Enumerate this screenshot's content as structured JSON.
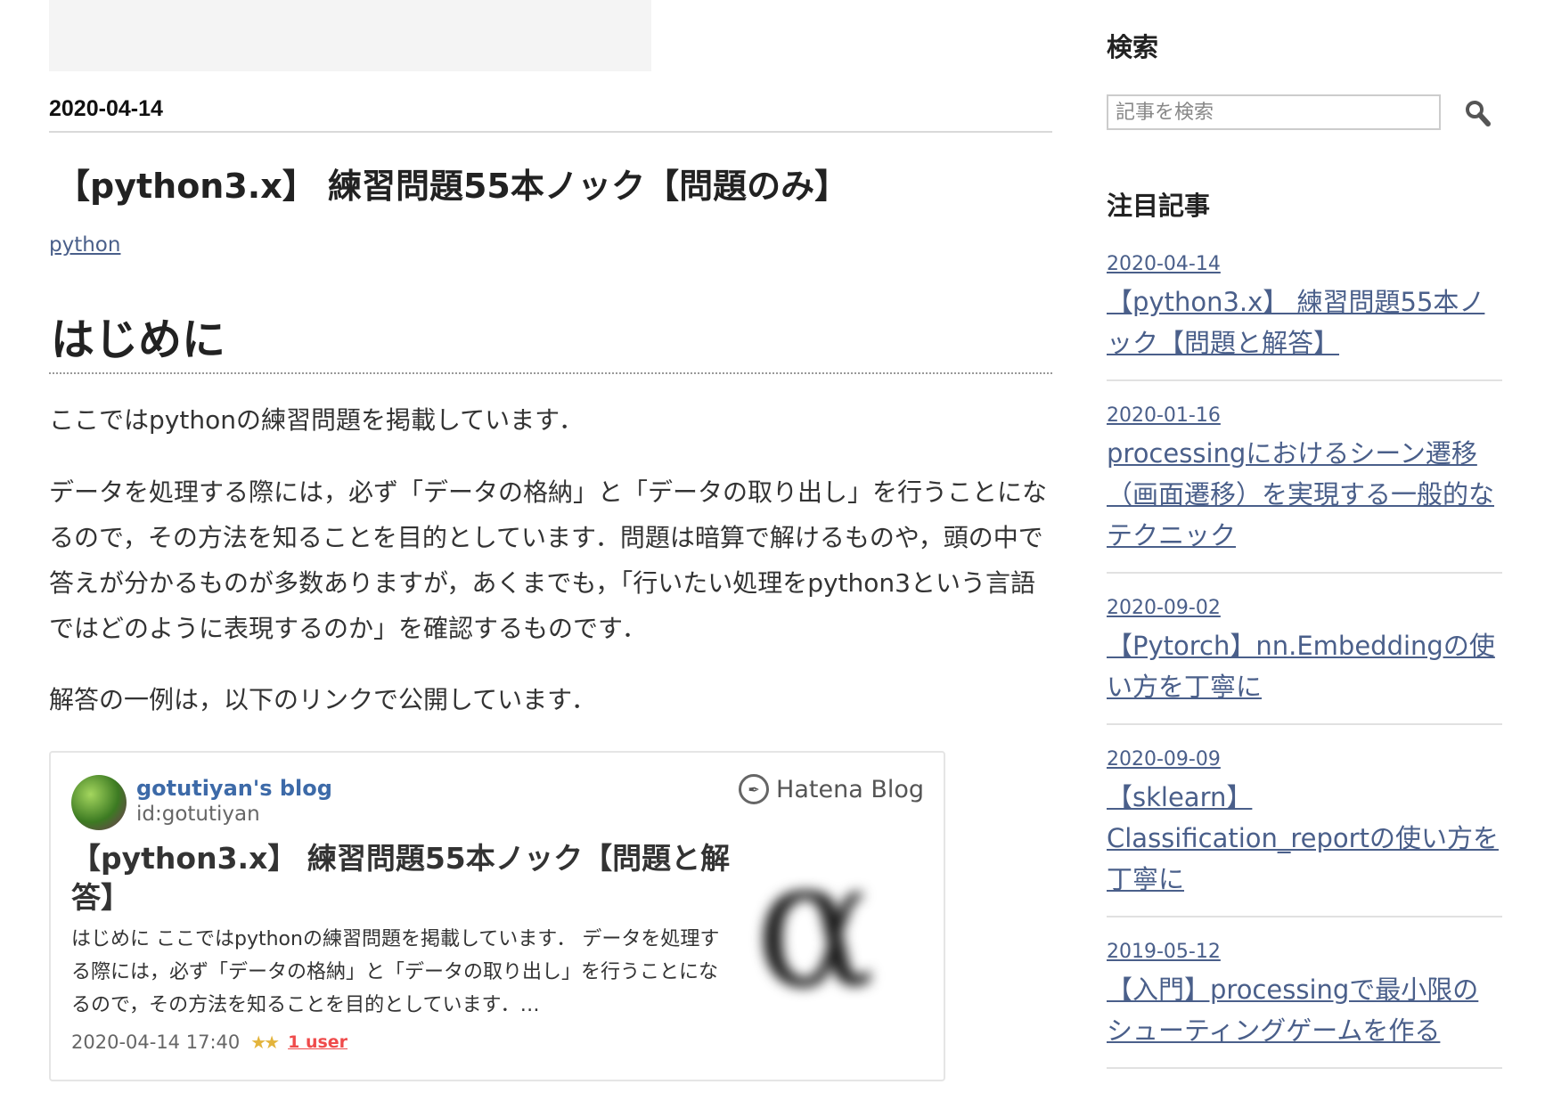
{
  "article": {
    "date": "2020-04-14",
    "title": "【python3.x】 練習問題55本ノック【問題のみ】",
    "category": "python",
    "section_heading": "はじめに",
    "paragraphs": [
      "ここではpythonの練習問題を掲載しています．",
      "データを処理する際には，必ず「データの格納」と「データの取り出し」を行うことになるので，その方法を知ることを目的としています．問題は暗算で解けるものや，頭の中で答えが分かるものが多数ありますが，あくまでも，「行いたい処理をpython3という言語ではどのように表現するのか」を確認するものです．",
      "解答の一例は，以下のリンクで公開しています．"
    ]
  },
  "embed_card": {
    "blog_name": "gotutiyan's blog",
    "user_id": "id:gotutiyan",
    "brand": "Hatena Blog",
    "title": "【python3.x】 練習問題55本ノック【問題と解答】",
    "excerpt": "はじめに ここではpythonの練習問題を掲載しています． データを処理する際には，必ず「データの格納」と「データの取り出し」を行うことになるので，その方法を知ることを目的としています．…",
    "timestamp": "2020-04-14 17:40",
    "bookmark_users": "1 user",
    "thumbnail_glyph": "α"
  },
  "sidebar": {
    "search_heading": "検索",
    "search_placeholder": "記事を検索",
    "featured_heading": "注目記事",
    "featured": [
      {
        "date": "2020-04-14",
        "title": "【python3.x】 練習問題55本ノック【問題と解答】"
      },
      {
        "date": "2020-01-16",
        "title": "processingにおけるシーン遷移（画面遷移）を実現する一般的なテクニック"
      },
      {
        "date": "2020-09-02",
        "title": "【Pytorch】nn.Embeddingの使い方を丁寧に"
      },
      {
        "date": "2020-09-09",
        "title": "【sklearn】 Classification_reportの使い方を丁寧に"
      },
      {
        "date": "2019-05-12",
        "title": "【入門】processingで最小限のシューティングゲームを作る"
      }
    ]
  },
  "colors": {
    "link": "#4a5f8a",
    "blog_name": "#3d6aa8",
    "bookmark": "#ef4b4b",
    "star": "#e3b43c"
  },
  "icons": [
    "search-icon",
    "hatena-pen-icon",
    "star-icon",
    "avatar"
  ]
}
